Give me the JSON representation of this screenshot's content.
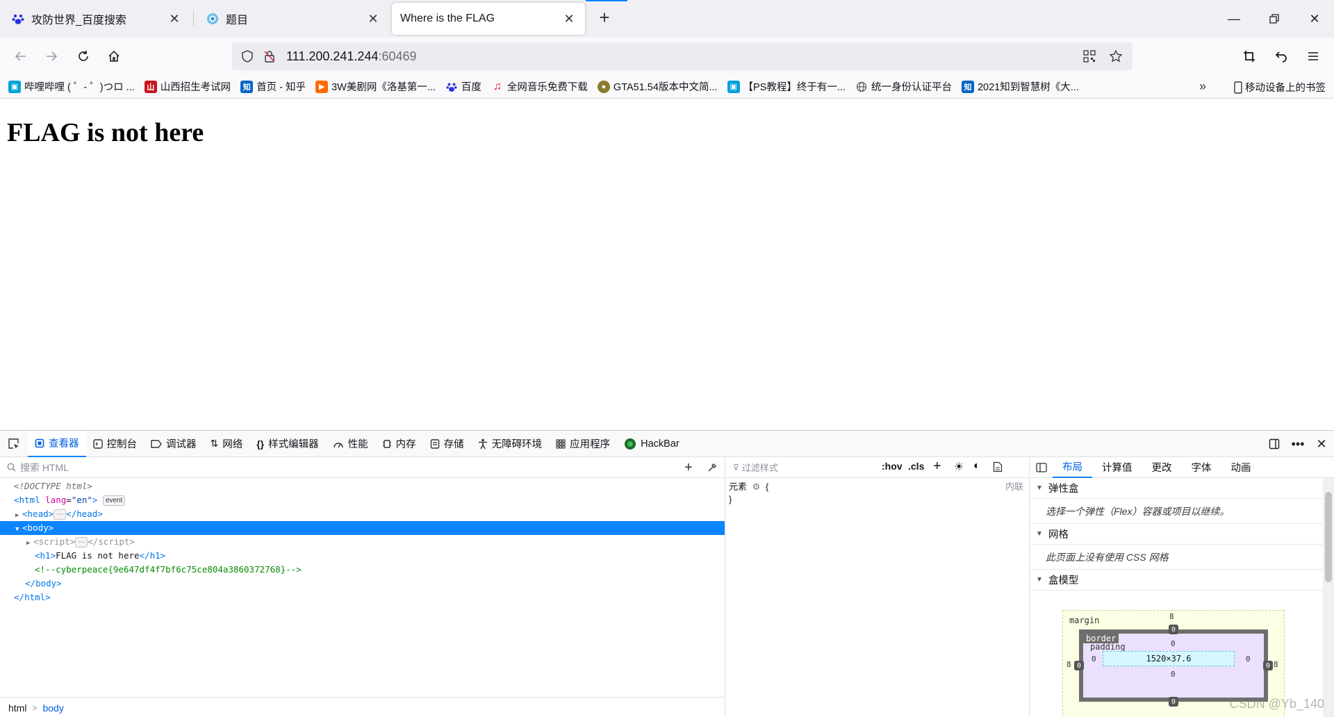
{
  "browser": {
    "tabs": [
      {
        "title": "攻防世界_百度搜索",
        "icon": "baidu-paw-icon"
      },
      {
        "title": "题目",
        "icon": "site-icon"
      },
      {
        "title": "Where is the FLAG",
        "icon": "none",
        "active": true
      }
    ],
    "url": {
      "host": "111.200.241.244",
      "port": ":60469"
    }
  },
  "bookmarks": {
    "items": [
      {
        "label": "哔哩哔哩 ( ゜- ゜)つロ ...",
        "color": "#00a1d6"
      },
      {
        "label": "山西招生考试网",
        "color": "#c8161d"
      },
      {
        "label": "首页 - 知乎",
        "color": "#0a66c2",
        "glyph": "知"
      },
      {
        "label": "3W美剧网《洛基第一...",
        "color": "#ff6a00"
      },
      {
        "label": "百度",
        "color": "#2932e1"
      },
      {
        "label": "全网音乐免费下载",
        "color": "#e8142c"
      },
      {
        "label": "GTA51.54版本中文简...",
        "color": "#8a7b2c"
      },
      {
        "label": "【PS教程】终于有一...",
        "color": "#00a1d6"
      },
      {
        "label": "统一身份认证平台",
        "color": "#555555"
      },
      {
        "label": "2021知到智慧树《大...",
        "color": "#0a66c2",
        "glyph": "知"
      }
    ],
    "mobile": "移动设备上的书签"
  },
  "page": {
    "heading": "FLAG is not here"
  },
  "devtools": {
    "tabs": [
      "查看器",
      "控制台",
      "调试器",
      "网络",
      "样式编辑器",
      "性能",
      "内存",
      "存储",
      "无障碍环境",
      "应用程序",
      "HackBar"
    ],
    "search_placeholder": "搜索 HTML",
    "markup": {
      "doctype": "<!DOCTYPE html>",
      "html_open": "html",
      "lang_attr": "lang",
      "lang_val": "\"en\"",
      "event_badge": "event",
      "head": "head",
      "body": "body",
      "script": "script",
      "h1_text": "FLAG is not here",
      "comment": "<!--cyberpeace{9e647df4f7bf6c75ce804a3860372768}-->"
    },
    "breadcrumb": [
      "html",
      "body"
    ],
    "rules": {
      "filter_placeholder": "过滤样式",
      "hov": ":hov",
      "cls": ".cls",
      "element_label": "元素",
      "open_brace": "{",
      "close_brace": "}",
      "inline": "内联"
    },
    "layout": {
      "tabs": [
        "布局",
        "计算值",
        "更改",
        "字体",
        "动画"
      ],
      "flex_title": "弹性盒",
      "flex_msg": "选择一个弹性（Flex）容器或项目以继续。",
      "grid_title": "网格",
      "grid_msg": "此页面上没有使用 CSS 网格",
      "box_title": "盒模型",
      "box": {
        "margin_label": "margin",
        "border_label": "border",
        "padding_label": "padding",
        "content": "1520×37.6",
        "margin_top": "8",
        "margin_left": "8",
        "margin_right": "8",
        "border_top": "0",
        "border_left": "0",
        "border_right": "0",
        "border_bottom": "0",
        "padding_top": "0",
        "padding_left": "0",
        "padding_right": "0",
        "padding_bottom": "0"
      }
    }
  },
  "watermark": "CSDN @Yb_140"
}
